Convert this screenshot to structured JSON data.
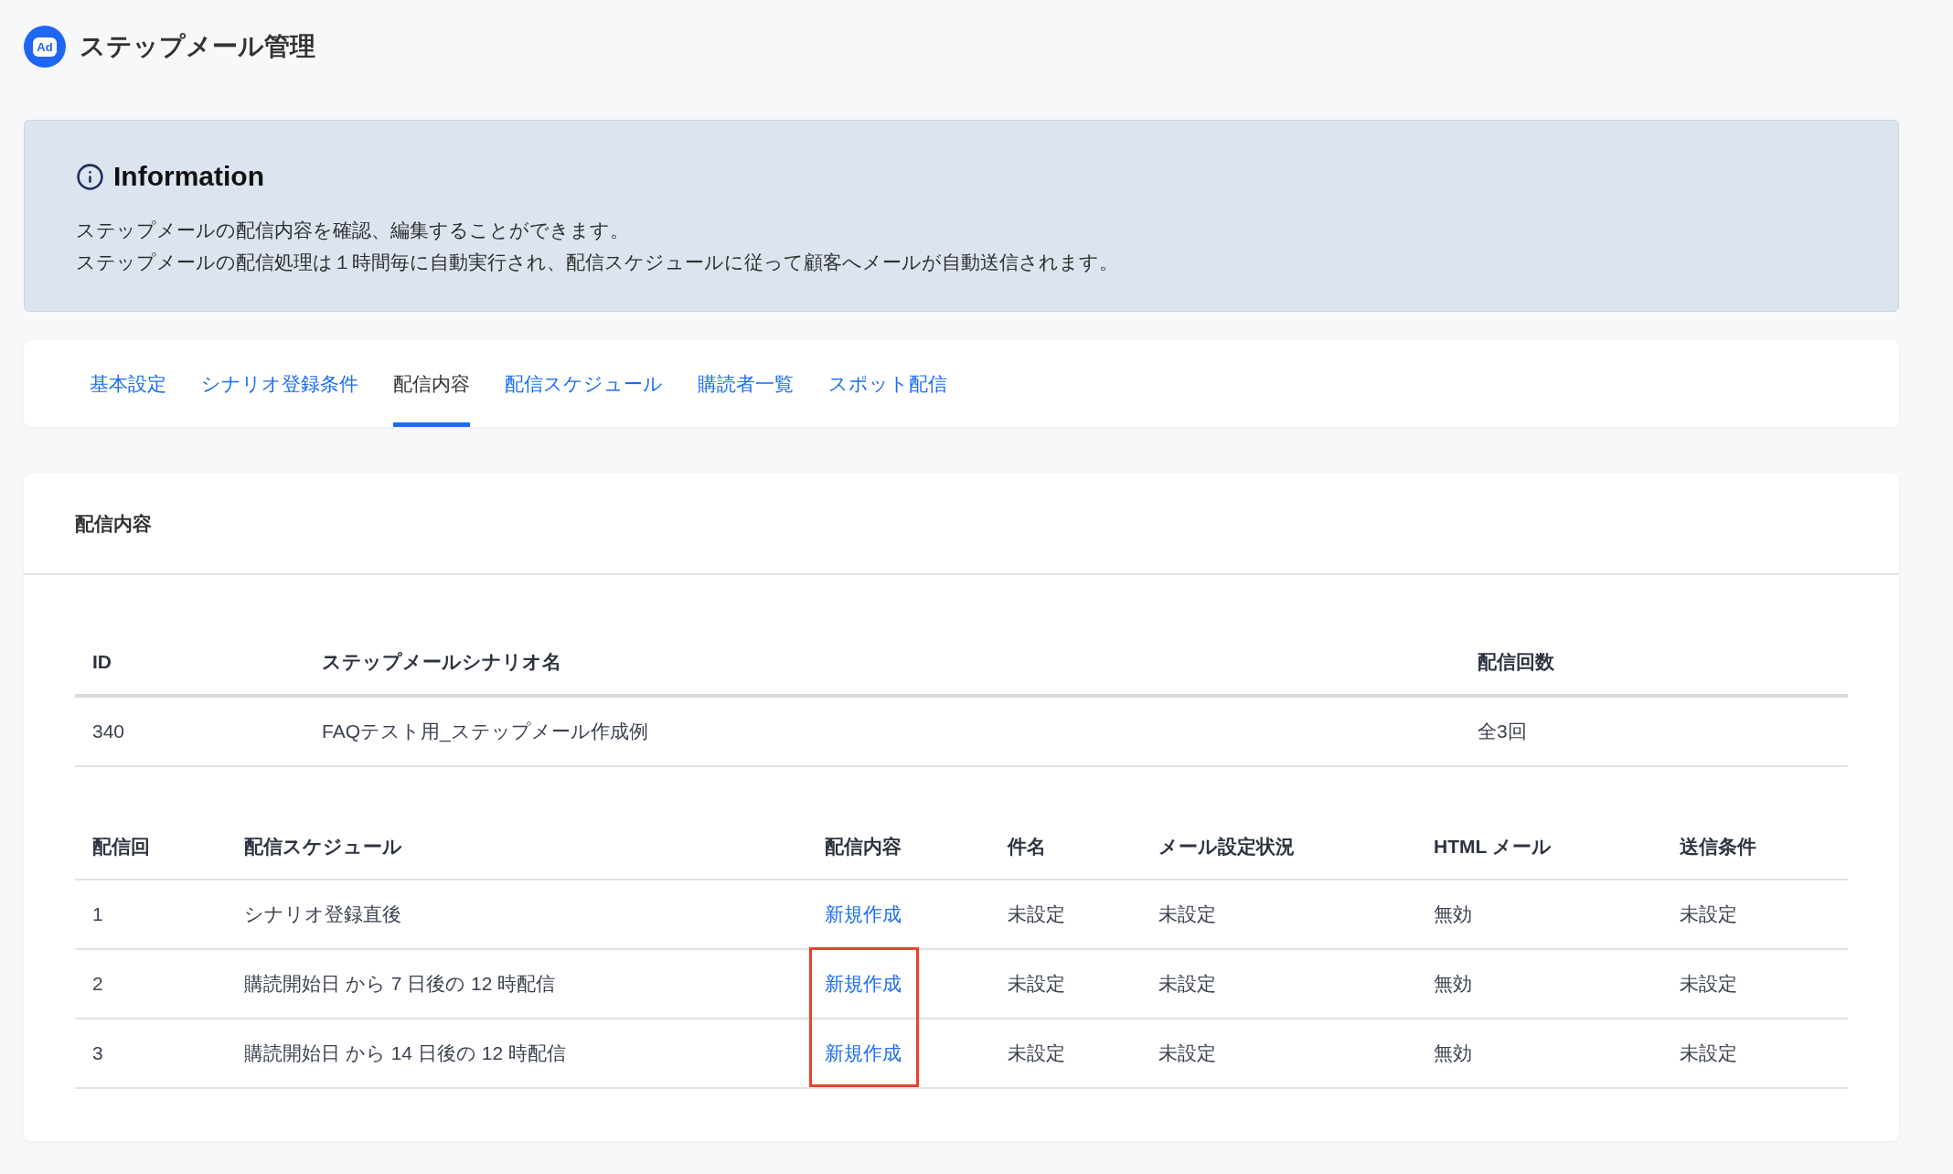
{
  "header": {
    "logo_text": "Ad",
    "title": "ステップメール管理"
  },
  "information": {
    "title": "Information",
    "lines": [
      "ステップメールの配信内容を確認、編集することができます。",
      "ステップメールの配信処理は１時間毎に自動実行され、配信スケジュールに従って顧客へメールが自動送信されます。"
    ]
  },
  "tabs": [
    {
      "label": "基本設定",
      "selected": false
    },
    {
      "label": "シナリオ登録条件",
      "selected": false
    },
    {
      "label": "配信内容",
      "selected": true
    },
    {
      "label": "配信スケジュール",
      "selected": false
    },
    {
      "label": "購読者一覧",
      "selected": false
    },
    {
      "label": "スポット配信",
      "selected": false
    }
  ],
  "content_panel": {
    "title": "配信内容",
    "scenario_table": {
      "columns": [
        "ID",
        "ステップメールシナリオ名",
        "配信回数"
      ],
      "rows": [
        [
          "340",
          "FAQテスト用_ステップメール作成例",
          "全3回"
        ]
      ]
    },
    "schedule_table": {
      "columns": [
        "配信回",
        "配信スケジュール",
        "配信内容",
        "件名",
        "メール設定状況",
        "HTML メール",
        "送信条件"
      ],
      "rows": [
        {
          "highlighted": false,
          "cells": [
            {
              "kind": "text",
              "text": "1"
            },
            {
              "kind": "text",
              "text": "シナリオ登録直後"
            },
            {
              "kind": "link",
              "text": "新規作成"
            },
            {
              "kind": "text",
              "text": "未設定"
            },
            {
              "kind": "text",
              "text": "未設定"
            },
            {
              "kind": "text",
              "text": "無効"
            },
            {
              "kind": "text",
              "text": "未設定"
            }
          ]
        },
        {
          "highlighted": true,
          "cells": [
            {
              "kind": "text",
              "text": "2"
            },
            {
              "kind": "text",
              "text": "購読開始日 から 7 日後の 12 時配信"
            },
            {
              "kind": "link",
              "text": "新規作成"
            },
            {
              "kind": "text",
              "text": "未設定"
            },
            {
              "kind": "text",
              "text": "未設定"
            },
            {
              "kind": "text",
              "text": "無効"
            },
            {
              "kind": "text",
              "text": "未設定"
            }
          ]
        },
        {
          "highlighted": true,
          "cells": [
            {
              "kind": "text",
              "text": "3"
            },
            {
              "kind": "text",
              "text": "購読開始日 から 14 日後の 12 時配信"
            },
            {
              "kind": "link",
              "text": "新規作成"
            },
            {
              "kind": "text",
              "text": "未設定"
            },
            {
              "kind": "text",
              "text": "未設定"
            },
            {
              "kind": "text",
              "text": "無効"
            },
            {
              "kind": "text",
              "text": "未設定"
            }
          ]
        }
      ]
    }
  }
}
